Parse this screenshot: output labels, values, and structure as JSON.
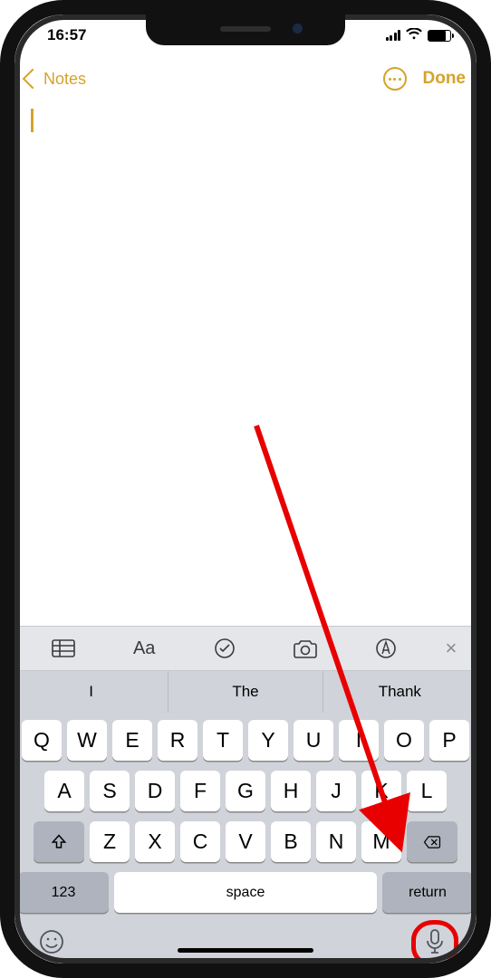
{
  "status": {
    "time": "16:57"
  },
  "nav": {
    "back_label": "Notes",
    "done_label": "Done"
  },
  "format_bar": {
    "close_glyph": "×"
  },
  "predictions": [
    "I",
    "The",
    "Thank"
  ],
  "keyboard": {
    "row1": [
      "Q",
      "W",
      "E",
      "R",
      "T",
      "Y",
      "U",
      "I",
      "O",
      "P"
    ],
    "row2": [
      "A",
      "S",
      "D",
      "F",
      "G",
      "H",
      "J",
      "K",
      "L"
    ],
    "row3": [
      "Z",
      "X",
      "C",
      "V",
      "B",
      "N",
      "M"
    ],
    "numeric_label": "123",
    "space_label": "space",
    "return_label": "return"
  }
}
